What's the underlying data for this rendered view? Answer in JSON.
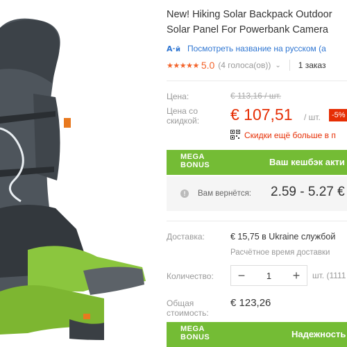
{
  "product": {
    "title_line1": "New! Hiking Solar Backpack Outdoor",
    "title_line2": "Solar Panel For Powerbank Camera"
  },
  "translate": {
    "icon": "translate-icon",
    "link": "Посмотреть название на русском (а"
  },
  "rating": {
    "stars": "★★★★★",
    "score": "5.0",
    "votes": "(4 голоса(ов))",
    "orders": "1 заказ"
  },
  "price": {
    "label_price": "Цена:",
    "old_price": "€ 113,16 / шт.",
    "label_discount_line1": "Цена со",
    "label_discount_line2": "скидкой:",
    "current": "€ 107,51",
    "per_unit": "/ шт.",
    "discount_badge": "-5%",
    "promo_text": "Скидки ещё больше в п",
    "accent_color": "#e62e04"
  },
  "mega_bonus_1": {
    "logo_line1": "MEGA",
    "logo_line2": "BONUS",
    "text": "Ваш кешбэк акти"
  },
  "cashback": {
    "label": "Вам вернётся:",
    "value": "2.59 - 5.27 €"
  },
  "shipping": {
    "label": "Доставка:",
    "price": "€ 15,75 в Ukraine службой",
    "estimate": "Расчётное время доставки"
  },
  "quantity": {
    "label": "Количество:",
    "minus": "−",
    "value": "1",
    "plus": "+",
    "unit_info": "шт. (1111"
  },
  "total": {
    "label_line1": "Общая",
    "label_line2": "стоимость:",
    "value": "€ 123,26"
  },
  "mega_bonus_2": {
    "logo_line1": "MEGA",
    "logo_line2": "BONUS",
    "text": "Надежность"
  },
  "colors": {
    "green": "#74bc35",
    "link_blue": "#2f76d2",
    "star_orange": "#f3632a"
  }
}
